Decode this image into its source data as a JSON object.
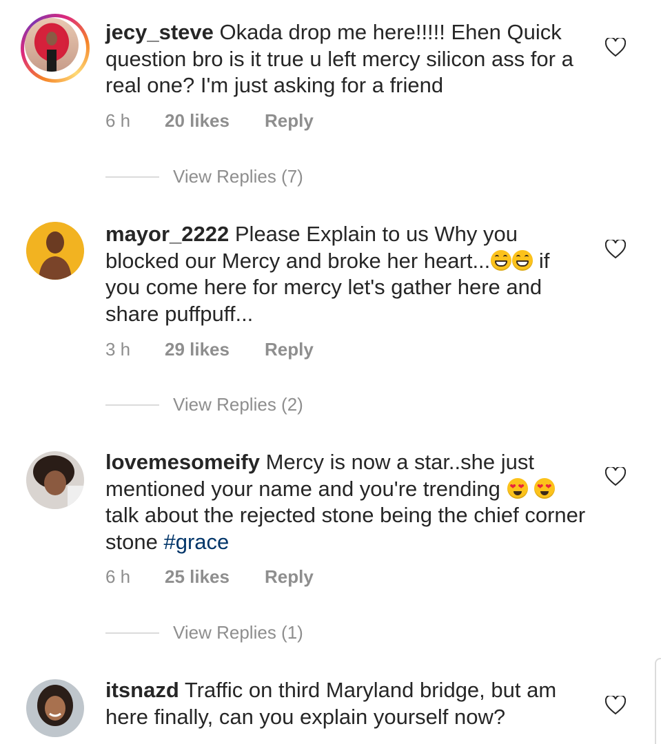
{
  "comments": [
    {
      "username": "jecy_steve",
      "text": "Okada drop me here!!!!! Ehen Quick question bro is it true u left mercy silicon ass for a real one? I'm just asking for a friend",
      "time": "6 h",
      "likes": "20 likes",
      "reply": "Reply",
      "view_replies": "View Replies (7)",
      "has_story": true,
      "avatar_icon": "profile-photo-red-hair"
    },
    {
      "username": "mayor_2222",
      "text_before_emoji": "Please Explain to us Why you blocked our Mercy and broke her heart...",
      "emoji": [
        "grinning-face-icon",
        "grinning-face-icon"
      ],
      "text_after_emoji": "if you come here for mercy let's gather here and share puffpuff...",
      "time": "3 h",
      "likes": "29 likes",
      "reply": "Reply",
      "view_replies": "View Replies (2)",
      "has_story": false,
      "avatar_icon": "profile-photo-man"
    },
    {
      "username": "lovemesomeify",
      "text_before_emoji": "Mercy is now a star..she just mentioned your name and you're trending",
      "emoji": [
        "heart-eyes-icon",
        "heart-eyes-icon"
      ],
      "text_after_emoji": "talk about the rejected stone being the chief corner stone",
      "hashtag": "#grace",
      "time": "6 h",
      "likes": "25 likes",
      "reply": "Reply",
      "view_replies": "View Replies (1)",
      "has_story": false,
      "avatar_icon": "profile-photo-woman-afro"
    },
    {
      "username": "itsnazd",
      "text": "Traffic on third Maryland bridge, but am here finally, can you explain yourself now?",
      "has_story": false,
      "avatar_icon": "profile-photo-woman-smiling"
    }
  ],
  "colors": {
    "text": "#262626",
    "muted": "#8e8e8e",
    "hashtag": "#003569",
    "divider": "#dbdbdb"
  }
}
